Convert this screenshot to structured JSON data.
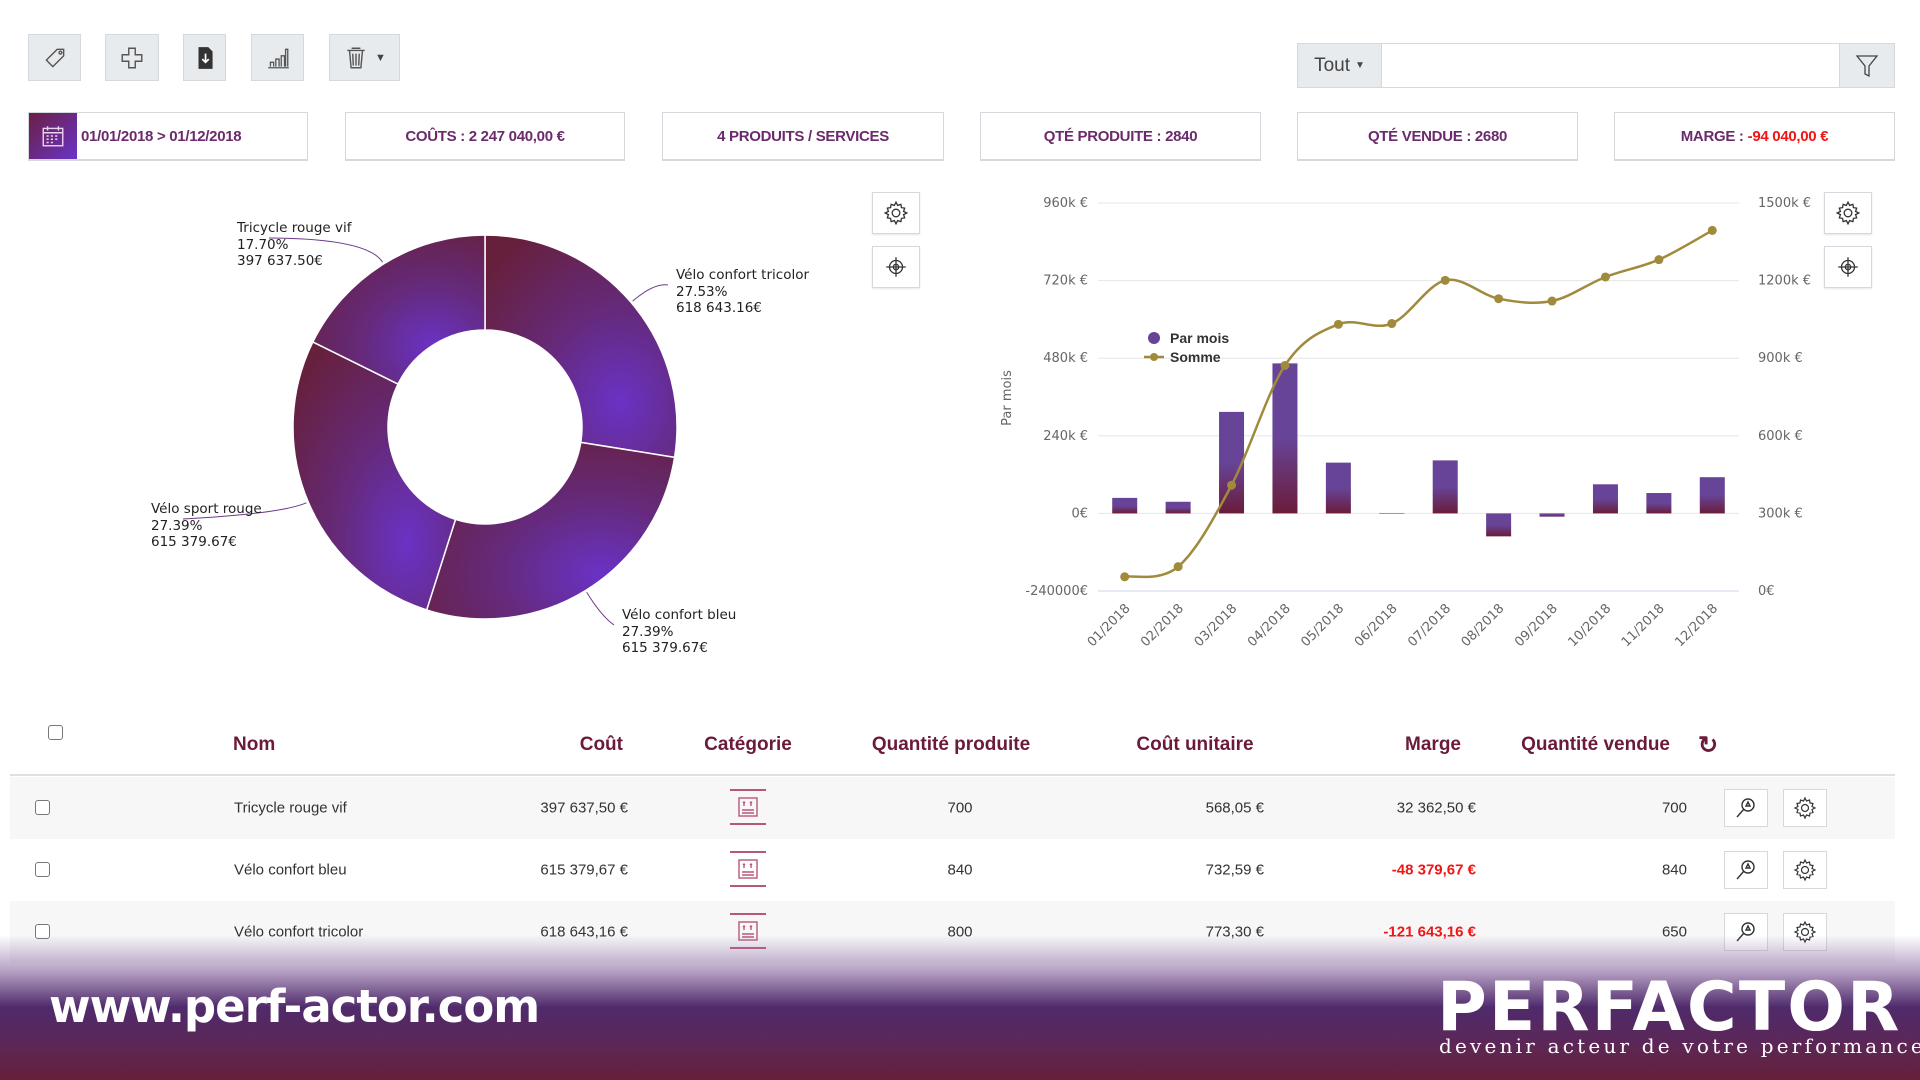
{
  "toolbar": {
    "buttons": [
      {
        "icon": "tag-icon"
      },
      {
        "icon": "plus-icon"
      },
      {
        "icon": "file-download-icon"
      },
      {
        "icon": "bar-chart-icon"
      },
      {
        "icon": "trash-icon",
        "dropdown": true
      }
    ]
  },
  "filter": {
    "scope_value": "Tout",
    "search_value": "",
    "search_placeholder": "",
    "filter_icon": "funnel-icon"
  },
  "stats": {
    "date_range": "01/01/2018 > 01/12/2018",
    "costs": "COÛTS : 2 247 040,00 €",
    "products": "4 PRODUITS / SERVICES",
    "qty_produced": "QTÉ PRODUITE : 2840",
    "qty_sold": "QTÉ VENDUE : 2680",
    "margin_label": "MARGE :",
    "margin_value": "-94 040,00 €"
  },
  "colors": {
    "accent": "#6b2a6b",
    "negative": "#f01616",
    "bar": "#674497",
    "line": "#a08a3c",
    "header": "#6b1a3a"
  },
  "chart_data": [
    {
      "type": "pie",
      "donut": true,
      "slices": [
        {
          "name": "Vélo confort tricolor",
          "percent": "27.53%",
          "value": "618 643.16€",
          "share": 27.53
        },
        {
          "name": "Vélo confort bleu",
          "percent": "27.39%",
          "value": "615 379.67€",
          "share": 27.39
        },
        {
          "name": "Vélo sport rouge",
          "percent": "27.39%",
          "value": "615 379.67€",
          "share": 27.39
        },
        {
          "name": "Tricycle rouge vif",
          "percent": "17.70%",
          "value": "397 637.50€",
          "share": 17.7
        }
      ]
    },
    {
      "type": "bar+line",
      "categories": [
        "01/2018",
        "02/2018",
        "03/2018",
        "04/2018",
        "05/2018",
        "06/2018",
        "07/2018",
        "08/2018",
        "09/2018",
        "10/2018",
        "11/2018",
        "12/2018"
      ],
      "series": [
        {
          "name": "Par mois",
          "type": "bar",
          "axis": "left",
          "values": [
            48000,
            36000,
            314000,
            464000,
            157000,
            0,
            164000,
            -71000,
            -10000,
            90000,
            63000,
            112000
          ]
        },
        {
          "name": "Somme",
          "type": "line",
          "axis": "right",
          "values": [
            55000,
            94000,
            409000,
            872000,
            1031000,
            1034000,
            1201000,
            1130000,
            1121000,
            1214000,
            1281000,
            1394000
          ]
        }
      ],
      "ylabel": "Par mois",
      "y2label": "Somme",
      "ylim": [
        -240000,
        960000
      ],
      "y2lim": [
        0,
        1500000
      ],
      "yticks": [
        "-240000€",
        "0€",
        "240k €",
        "480k €",
        "720k €",
        "960k €"
      ],
      "y2ticks": [
        "0€",
        "300k €",
        "600k €",
        "900k €",
        "1200k €",
        "1500k €"
      ],
      "grid": true,
      "legend": "top-left"
    }
  ],
  "table": {
    "headers": {
      "name": "Nom",
      "cost": "Coût",
      "category": "Catégorie",
      "qty_produced": "Quantité produite",
      "unit_cost": "Coût unitaire",
      "margin": "Marge",
      "qty_sold": "Quantité vendue"
    },
    "rows": [
      {
        "name": "Tricycle rouge vif",
        "cost": "397 637,50 €",
        "qty_produced": "700",
        "unit_cost": "568,05 €",
        "margin": "32 362,50 €",
        "negative": false,
        "qty_sold": "700"
      },
      {
        "name": "Vélo confort bleu",
        "cost": "615 379,67 €",
        "qty_produced": "840",
        "unit_cost": "732,59 €",
        "margin": "-48 379,67 €",
        "negative": true,
        "qty_sold": "840"
      },
      {
        "name": "Vélo confort tricolor",
        "cost": "618 643,16 €",
        "qty_produced": "800",
        "unit_cost": "773,30 €",
        "margin": "-121 643,16 €",
        "negative": true,
        "qty_sold": "650"
      }
    ]
  },
  "footer": {
    "url": "www.perf-actor.com",
    "logo": "PERFACTOR",
    "tagline": "devenir acteur de votre performance"
  }
}
